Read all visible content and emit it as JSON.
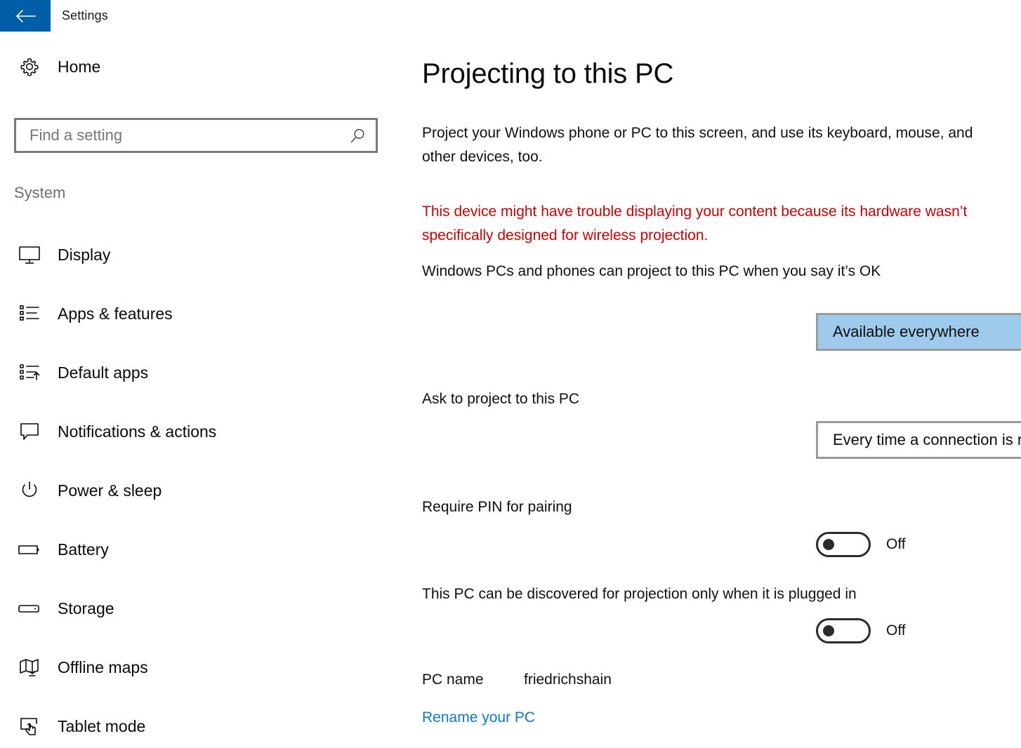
{
  "titlebar": {
    "back_icon": "back-arrow-icon",
    "title": "Settings",
    "accent_color": "#005fa8"
  },
  "sidebar": {
    "home": {
      "label": "Home",
      "icon": "gear-icon"
    },
    "search": {
      "placeholder": "Find a setting",
      "value": "",
      "icon": "search-icon"
    },
    "group_heading": "System",
    "items": [
      {
        "label": "Display",
        "icon": "monitor-icon"
      },
      {
        "label": "Apps & features",
        "icon": "app-list-icon"
      },
      {
        "label": "Default apps",
        "icon": "default-apps-icon"
      },
      {
        "label": "Notifications & actions",
        "icon": "speech-bubble-icon"
      },
      {
        "label": "Power & sleep",
        "icon": "power-icon"
      },
      {
        "label": "Battery",
        "icon": "battery-icon"
      },
      {
        "label": "Storage",
        "icon": "storage-icon"
      },
      {
        "label": "Offline maps",
        "icon": "map-download-icon"
      },
      {
        "label": "Tablet mode",
        "icon": "tablet-touch-icon"
      }
    ]
  },
  "main": {
    "title": "Projecting to this PC",
    "intro": "Project your Windows phone or PC to this screen, and use its keyboard, mouse, and other devices, too.",
    "warning": "This device might have trouble displaying your content because its hardware wasn’t specifically designed for wireless projection.",
    "warning_color": "#d20000",
    "consent_label": "Windows PCs and phones can project to this PC when you say it’s OK",
    "availability_dropdown": {
      "value": "Available everywhere",
      "chevron_icon": "chevron-down-icon",
      "highlight_color": "#9ecbeb"
    },
    "ask_label": "Ask to project to this PC",
    "ask_dropdown": {
      "value": "Every time a connection is requested",
      "chevron_icon": "chevron-down-icon"
    },
    "pin_label": "Require PIN for pairing",
    "pin_toggle": {
      "state": "Off"
    },
    "plugged_label": "This PC can be discovered for projection only when it is plugged in",
    "plugged_toggle": {
      "state": "Off"
    },
    "pcname_label": "PC name",
    "pcname_value": "friedrichshain",
    "rename_link": "Rename your PC",
    "link_color": "#0b78d0"
  }
}
